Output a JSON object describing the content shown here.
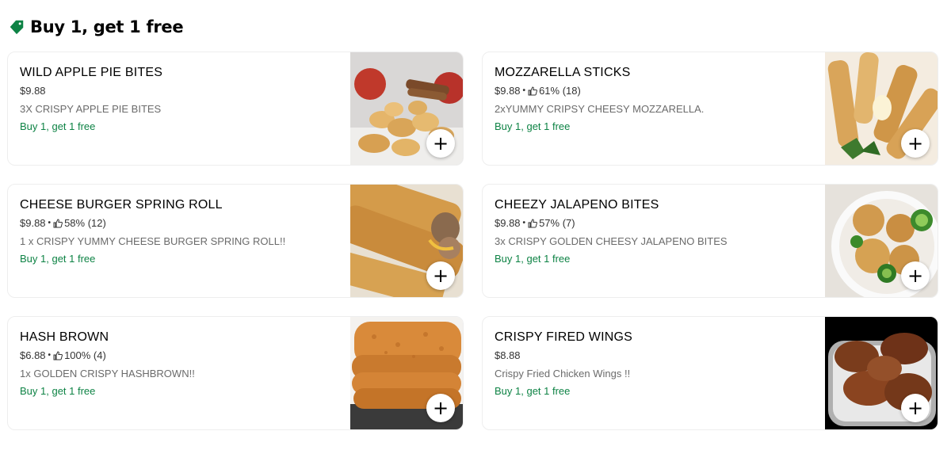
{
  "section": {
    "title": "Buy 1, get 1 free",
    "icon": "tag-icon",
    "icon_color": "#0e8345"
  },
  "colors": {
    "promo": "#0e8345",
    "description": "#6b6b6b"
  },
  "items": [
    {
      "name": "WILD APPLE PIE BITES",
      "price": "$9.88",
      "rating": "",
      "description": "3X CRISPY APPLE PIE BITES",
      "promo": "Buy 1, get 1 free",
      "add_label": "+"
    },
    {
      "name": "MOZZARELLA STICKS",
      "price": "$9.88",
      "rating": "61% (18)",
      "description": "2xYUMMY CRIPSY CHEESY MOZZARELLA.",
      "promo": "Buy 1, get 1 free",
      "add_label": "+"
    },
    {
      "name": "CHEESE BURGER SPRING ROLL",
      "price": "$9.88",
      "rating": "58% (12)",
      "description": "1 x CRISPY YUMMY CHEESE BURGER SPRING ROLL!!",
      "promo": "Buy 1, get 1 free",
      "add_label": "+"
    },
    {
      "name": "CHEEZY JALAPENO BITES",
      "price": "$9.88",
      "rating": "57% (7)",
      "description": "3x CRISPY GOLDEN CHEESY JALAPENO BITES",
      "promo": "Buy 1, get 1 free",
      "add_label": "+"
    },
    {
      "name": "HASH BROWN",
      "price": "$6.88",
      "rating": "100% (4)",
      "description": "1x GOLDEN CRISPY HASHBROWN!!",
      "promo": "Buy 1, get 1 free",
      "add_label": "+"
    },
    {
      "name": "CRISPY FIRED WINGS",
      "price": "$8.88",
      "rating": "",
      "description": "Crispy Fried Chicken Wings !!",
      "promo": "Buy 1, get 1 free",
      "add_label": "+"
    }
  ]
}
